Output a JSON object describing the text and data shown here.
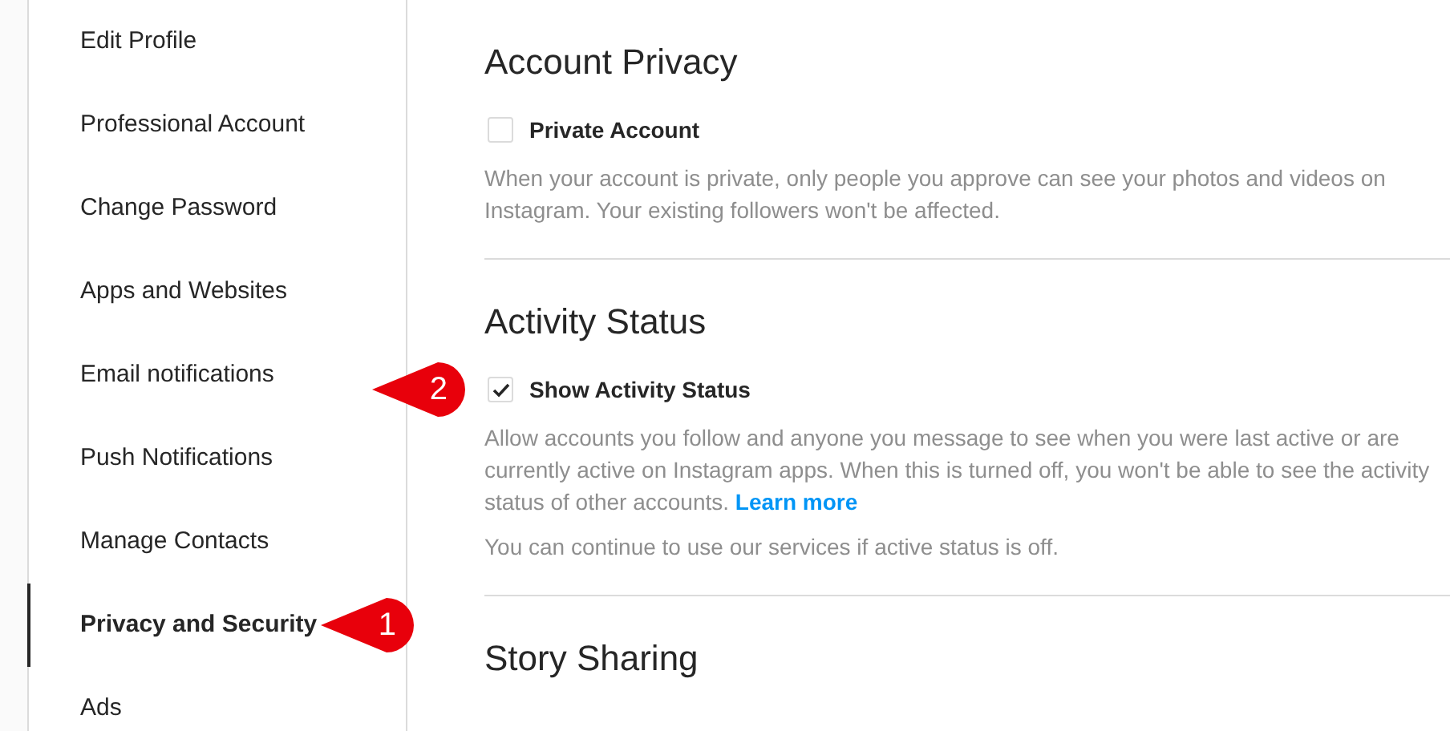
{
  "sidebar": {
    "items": [
      {
        "label": "Edit Profile",
        "selected": false
      },
      {
        "label": "Professional Account",
        "selected": false
      },
      {
        "label": "Change Password",
        "selected": false
      },
      {
        "label": "Apps and Websites",
        "selected": false
      },
      {
        "label": "Email notifications",
        "selected": false
      },
      {
        "label": "Push Notifications",
        "selected": false
      },
      {
        "label": "Manage Contacts",
        "selected": false
      },
      {
        "label": "Privacy and Security",
        "selected": true,
        "callout": "1"
      },
      {
        "label": "Ads",
        "selected": false
      }
    ]
  },
  "sections": [
    {
      "title": "Account Privacy",
      "option": {
        "label": "Private Account",
        "checked": false
      },
      "description": "When your account is private, only people you approve can see your photos and videos on Instagram. Your existing followers won't be affected."
    },
    {
      "title": "Activity Status",
      "option": {
        "label": "Show Activity Status",
        "checked": true,
        "callout": "2"
      },
      "description": "Allow accounts you follow and anyone you message to see when you were last active or are currently active on Instagram apps. When this is turned off, you won't be able to see the activity status of other accounts.",
      "link": "Learn more",
      "note": "You can continue to use our services if active status is off."
    },
    {
      "title": "Story Sharing"
    }
  ]
}
